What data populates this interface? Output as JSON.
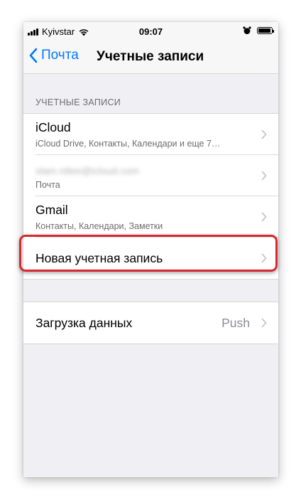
{
  "status_bar": {
    "carrier": "Kyivstar",
    "time": "09:07",
    "battery_level": 0.95
  },
  "nav": {
    "back_label": "Почта",
    "title": "Учетные записи"
  },
  "accounts_section": {
    "header": "УЧЕТНЫЕ ЗАПИСИ",
    "rows": [
      {
        "title": "iCloud",
        "subtitle": "iCloud Drive, Контакты, Календари и еще 7…"
      },
      {
        "title": "slam.n8ee@icloud.com",
        "subtitle": "Почта"
      },
      {
        "title": "Gmail",
        "subtitle": "Контакты, Календари, Заметки"
      },
      {
        "title": "Новая учетная запись"
      }
    ]
  },
  "fetch_section": {
    "title": "Загрузка данных",
    "value": "Push"
  },
  "colors": {
    "accent": "#007aff",
    "highlight": "#d7282f",
    "background": "#efeff4"
  }
}
